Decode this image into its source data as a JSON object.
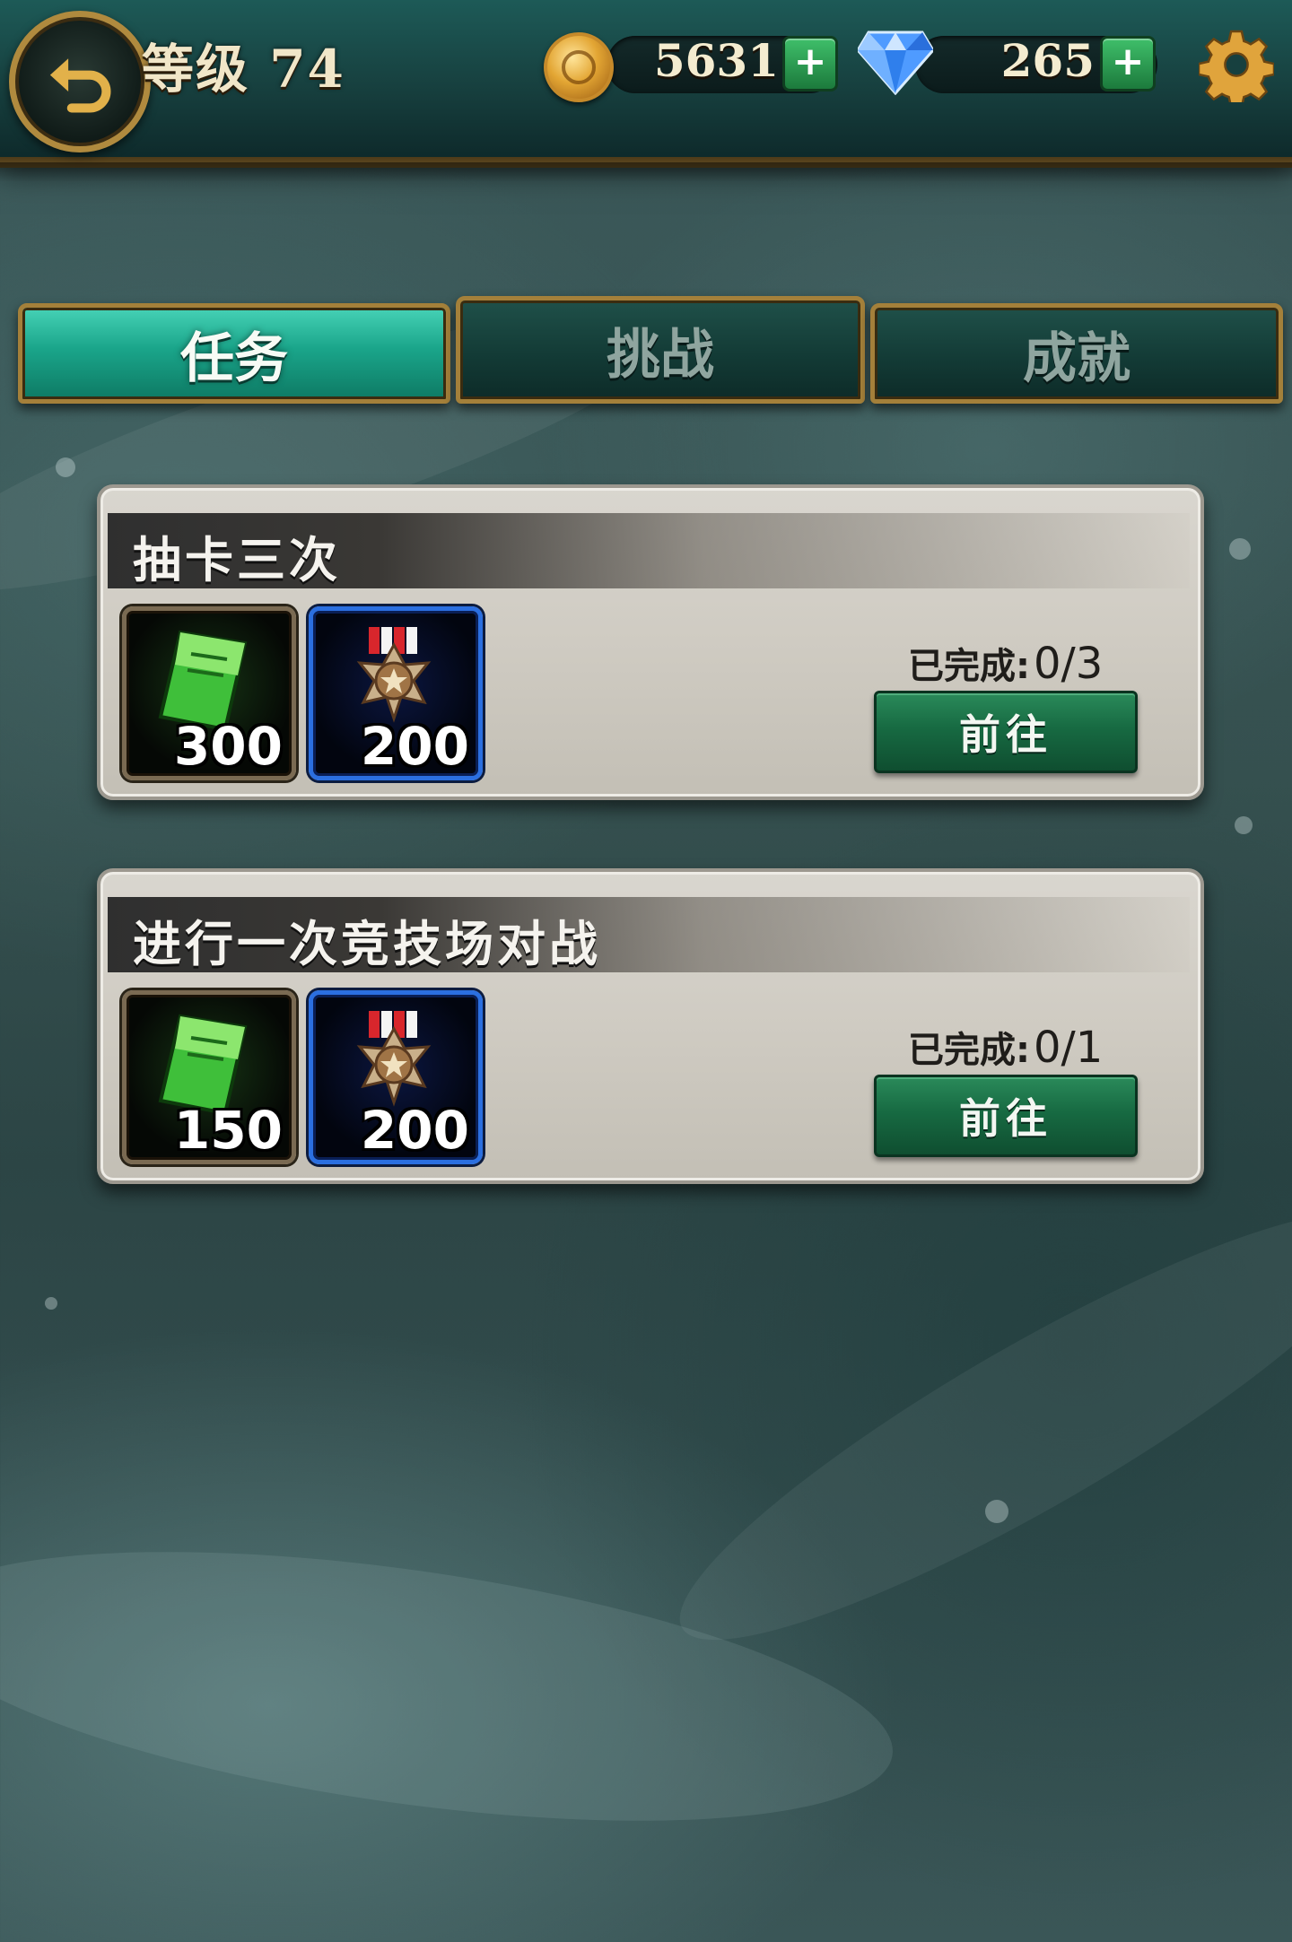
{
  "header": {
    "level_text": "等级 74",
    "gold_amount": "5631",
    "gem_amount": "265",
    "plus_symbol": "+"
  },
  "tabs": [
    {
      "label": "任务",
      "active": true
    },
    {
      "label": "挑战",
      "active": false
    },
    {
      "label": "成就",
      "active": false
    }
  ],
  "tasks": [
    {
      "title": "抽卡三次",
      "rewards": [
        {
          "icon": "green-ticket-icon",
          "count": "300"
        },
        {
          "icon": "medal-icon",
          "count": "200"
        }
      ],
      "progress_label": "已完成:",
      "progress_value": "0/3",
      "button_label": "前往"
    },
    {
      "title": "进行一次竞技场对战",
      "rewards": [
        {
          "icon": "green-ticket-icon",
          "count": "150"
        },
        {
          "icon": "medal-icon",
          "count": "200"
        }
      ],
      "progress_label": "已完成:",
      "progress_value": "0/1",
      "button_label": "前往"
    }
  ],
  "colors": {
    "accent_gold": "#a4803a",
    "tab_active": "#1aa58a",
    "button_green": "#176a42",
    "medal_frame_blue": "#2b6fe0"
  }
}
